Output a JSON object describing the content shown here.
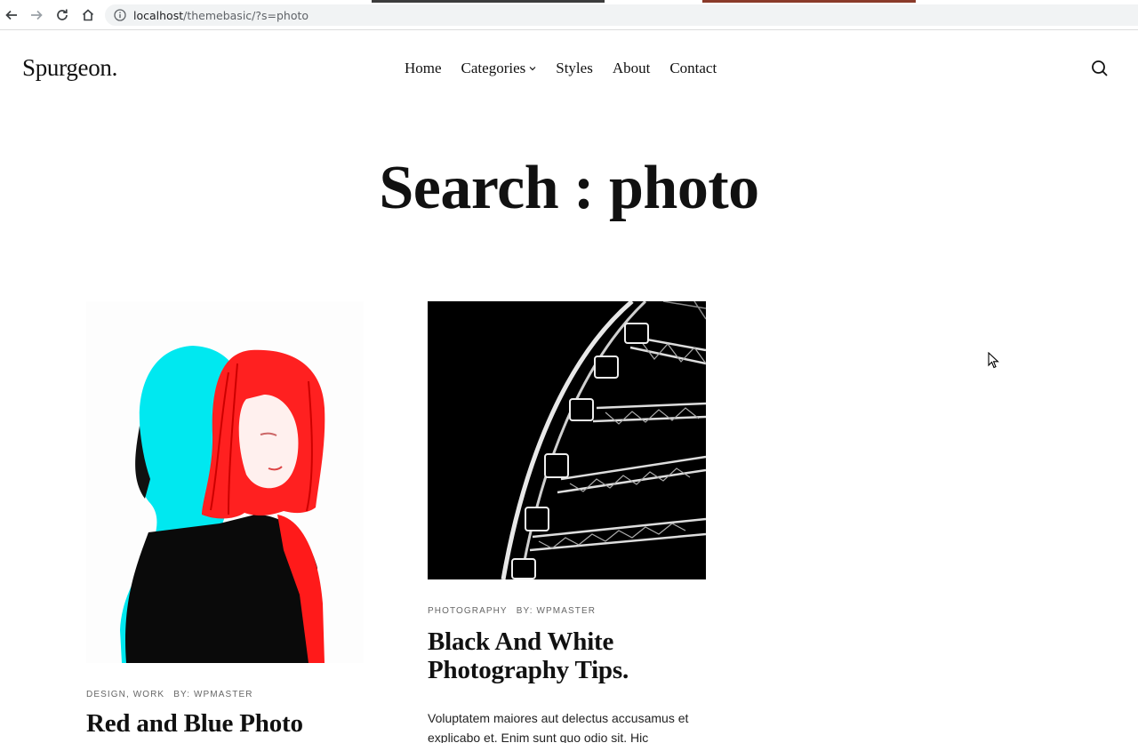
{
  "browser": {
    "url_host": "localhost",
    "url_path": "/themebasic/?s=photo"
  },
  "site": {
    "logo": "Spurgeon.",
    "nav": [
      {
        "label": "Home"
      },
      {
        "label": "Categories",
        "has_dropdown": true
      },
      {
        "label": "Styles"
      },
      {
        "label": "About"
      },
      {
        "label": "Contact"
      }
    ]
  },
  "page": {
    "title": "Search : photo"
  },
  "posts": [
    {
      "categories": "DESIGN, WORK",
      "author": "BY: WPMASTER",
      "title": "Red and Blue Photo",
      "image": "double-exposure-woman-red-cyan"
    },
    {
      "categories": "PHOTOGRAPHY",
      "author": "BY: WPMASTER",
      "title": "Black And White Photography Tips.",
      "excerpt": "Voluptatem maiores aut delectus accusamus et explicabo et. Enim sunt quo odio sit. Hic",
      "image": "ferris-wheel-black-white"
    }
  ],
  "colors": {
    "text": "#111111",
    "meta": "#666666",
    "address_bar": "#f1f3f4",
    "accent_red": "#ff1a1a",
    "accent_cyan": "#00e5ee"
  }
}
